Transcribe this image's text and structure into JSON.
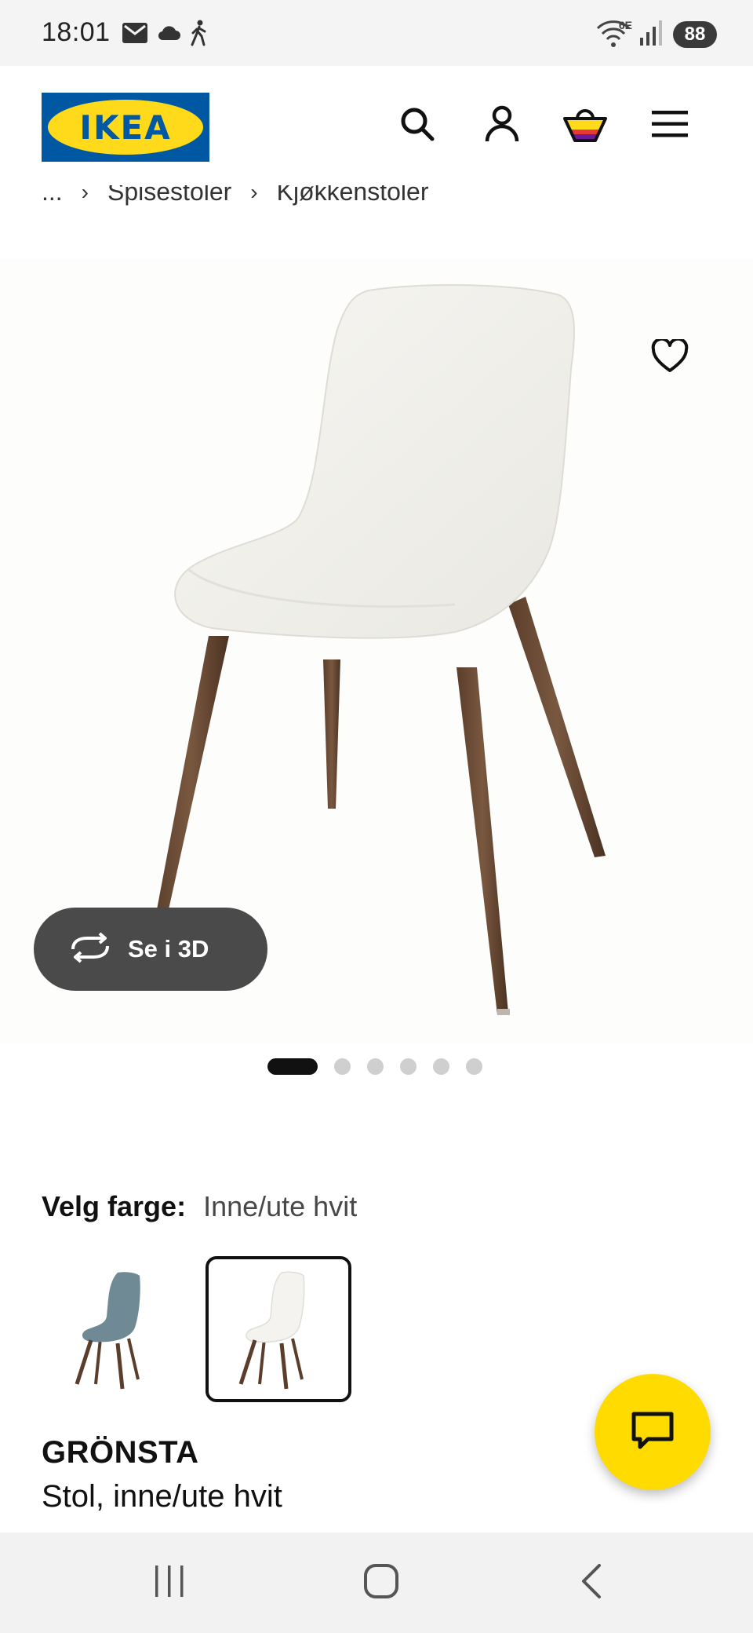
{
  "status_bar": {
    "time": "18:01",
    "network": "6E",
    "battery": "88",
    "left_icons": [
      "mail-icon",
      "cloud-icon",
      "walking-icon"
    ],
    "right_icons": [
      "wifi-icon",
      "signal-icon"
    ]
  },
  "header": {
    "logo_text": "IKEA",
    "icons": [
      "search-icon",
      "user-icon",
      "cart-icon",
      "menu-icon"
    ]
  },
  "breadcrumb": {
    "items": [
      "...",
      "Spisestoler",
      "Kjøkkenstoler"
    ]
  },
  "product_image": {
    "see_3d_label": "Se i 3D",
    "slide_count": 6,
    "active_slide": 1
  },
  "color": {
    "label": "Velg farge:",
    "value": "Inne/ute hvit",
    "options": [
      {
        "name": "blue-grey",
        "color": "#6f8a94",
        "selected": false
      },
      {
        "name": "white",
        "color": "#f4f3ef",
        "selected": true
      }
    ]
  },
  "product": {
    "name": "GRÖNSTA",
    "description": "Stol, inne/ute hvit"
  },
  "colors": {
    "ikea_blue": "#0058a3",
    "ikea_yellow": "#ffda1a",
    "chat_yellow": "#ffdb00"
  }
}
